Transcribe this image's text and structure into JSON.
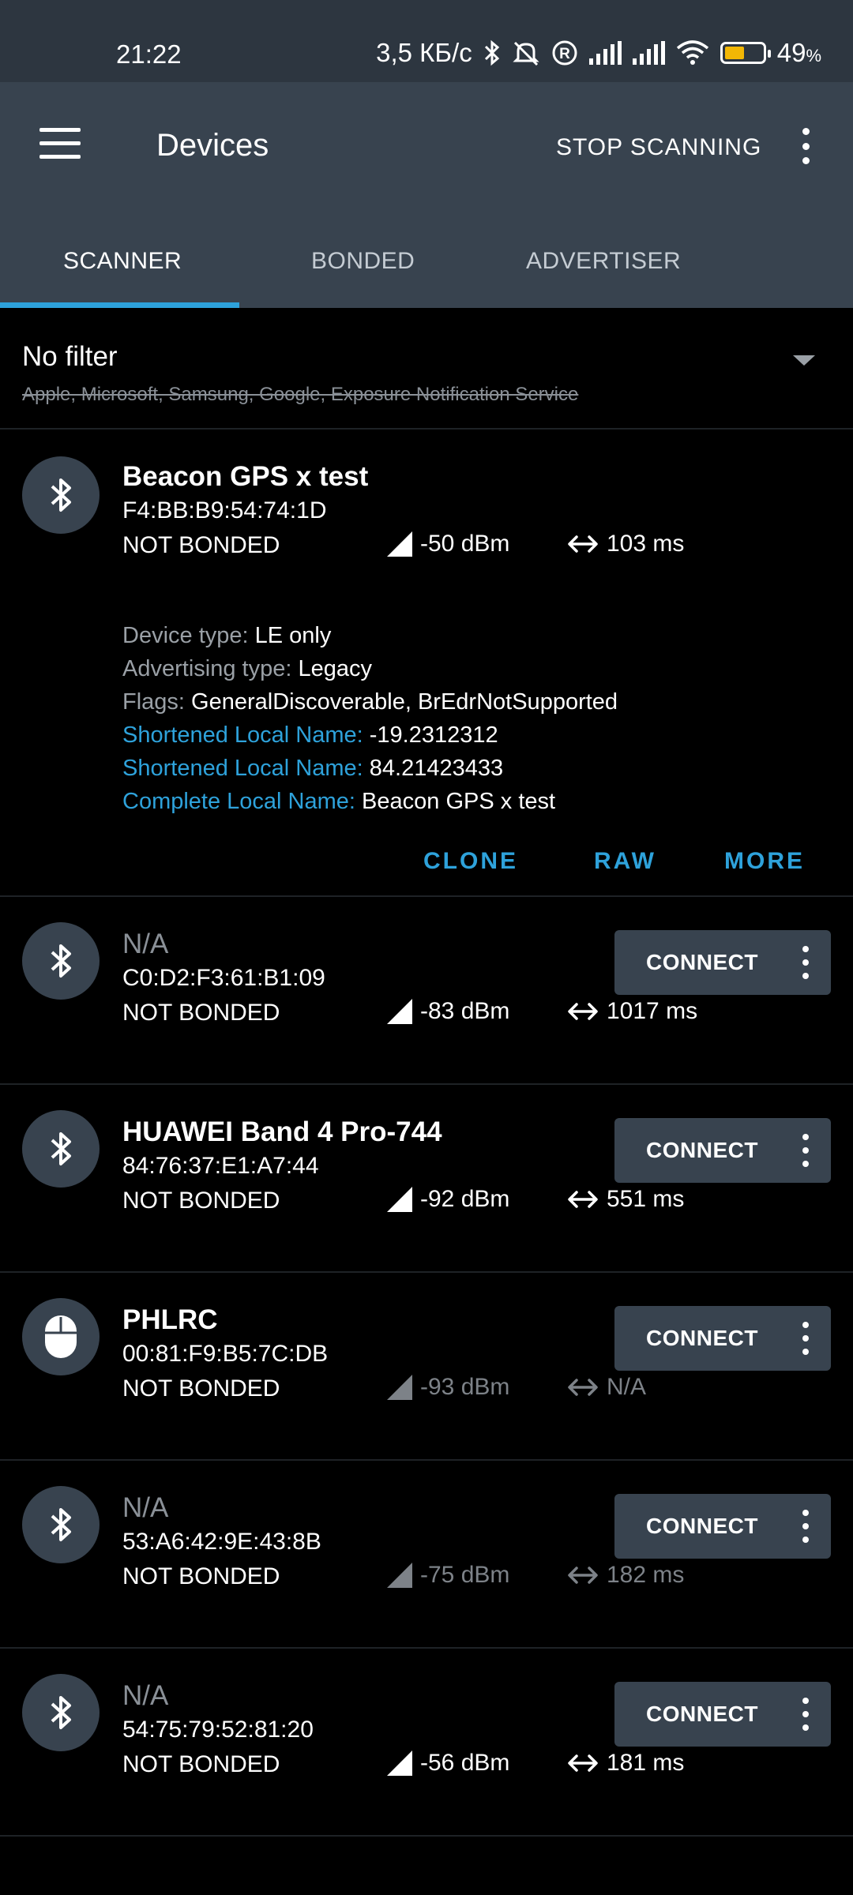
{
  "status_bar": {
    "time": "21:22",
    "network_speed": "3,5 КБ/с",
    "icons": [
      "bluetooth-icon",
      "muted-bell-icon",
      "registered-icon",
      "signal-icon",
      "signal-icon",
      "wifi-icon",
      "battery-icon"
    ],
    "battery_percent": "49",
    "battery_suffix": "%"
  },
  "app_bar": {
    "title": "Devices",
    "stop_scanning": "STOP SCANNING"
  },
  "tabs": [
    {
      "label": "SCANNER",
      "active": true
    },
    {
      "label": "BONDED",
      "active": false
    },
    {
      "label": "ADVERTISER",
      "active": false
    }
  ],
  "filter": {
    "title": "No filter",
    "subtitle": "Apple, Microsoft, Samsung, Google, Exposure Notification Service"
  },
  "devices": [
    {
      "name": "Beacon GPS x test",
      "address": "F4:BB:B9:54:74:1D",
      "bond": "NOT BONDED",
      "rssi": "-50 dBm",
      "interval": "103 ms",
      "icon": "bluetooth-icon",
      "expanded": true,
      "details": [
        {
          "key": "Device type:",
          "value": "LE only"
        },
        {
          "key": "Advertising type:",
          "value": "Legacy"
        },
        {
          "key": "Flags:",
          "value": "GeneralDiscoverable, BrEdrNotSupported"
        },
        {
          "key": "Shortened Local Name:",
          "value": "-19.2312312"
        },
        {
          "key": "Shortened Local Name:",
          "value": "84.21423433"
        },
        {
          "key": "Complete Local Name:",
          "value": "Beacon GPS x test"
        }
      ],
      "actions": [
        "CLONE",
        "RAW",
        "MORE"
      ]
    },
    {
      "name": "N/A",
      "address": "C0:D2:F3:61:B1:09",
      "bond": "NOT BONDED",
      "rssi": "-83 dBm",
      "interval": "1017 ms",
      "icon": "bluetooth-icon",
      "connect": "CONNECT"
    },
    {
      "name": "HUAWEI Band 4 Pro-744",
      "address": "84:76:37:E1:A7:44",
      "bond": "NOT BONDED",
      "rssi": "-92 dBm",
      "interval": "551 ms",
      "icon": "bluetooth-icon",
      "connect": "CONNECT"
    },
    {
      "name": "PHLRC",
      "address": "00:81:F9:B5:7C:DB",
      "bond": "NOT BONDED",
      "rssi": "-93 dBm",
      "interval": "N/A",
      "icon": "mouse-icon",
      "connect": "CONNECT"
    },
    {
      "name": "N/A",
      "address": "53:A6:42:9E:43:8B",
      "bond": "NOT BONDED",
      "rssi": "-75 dBm",
      "interval": "182 ms",
      "icon": "bluetooth-icon",
      "connect": "CONNECT"
    },
    {
      "name": "N/A",
      "address": "54:75:79:52:81:20",
      "bond": "NOT BONDED",
      "rssi": "-56 dBm",
      "interval": "181 ms",
      "icon": "bluetooth-icon",
      "connect": "CONNECT"
    }
  ],
  "colors": {
    "accent": "#2ea2db",
    "bar_bg": "#38434f",
    "status_bg": "#2d3640",
    "battery": "#f2b705"
  }
}
